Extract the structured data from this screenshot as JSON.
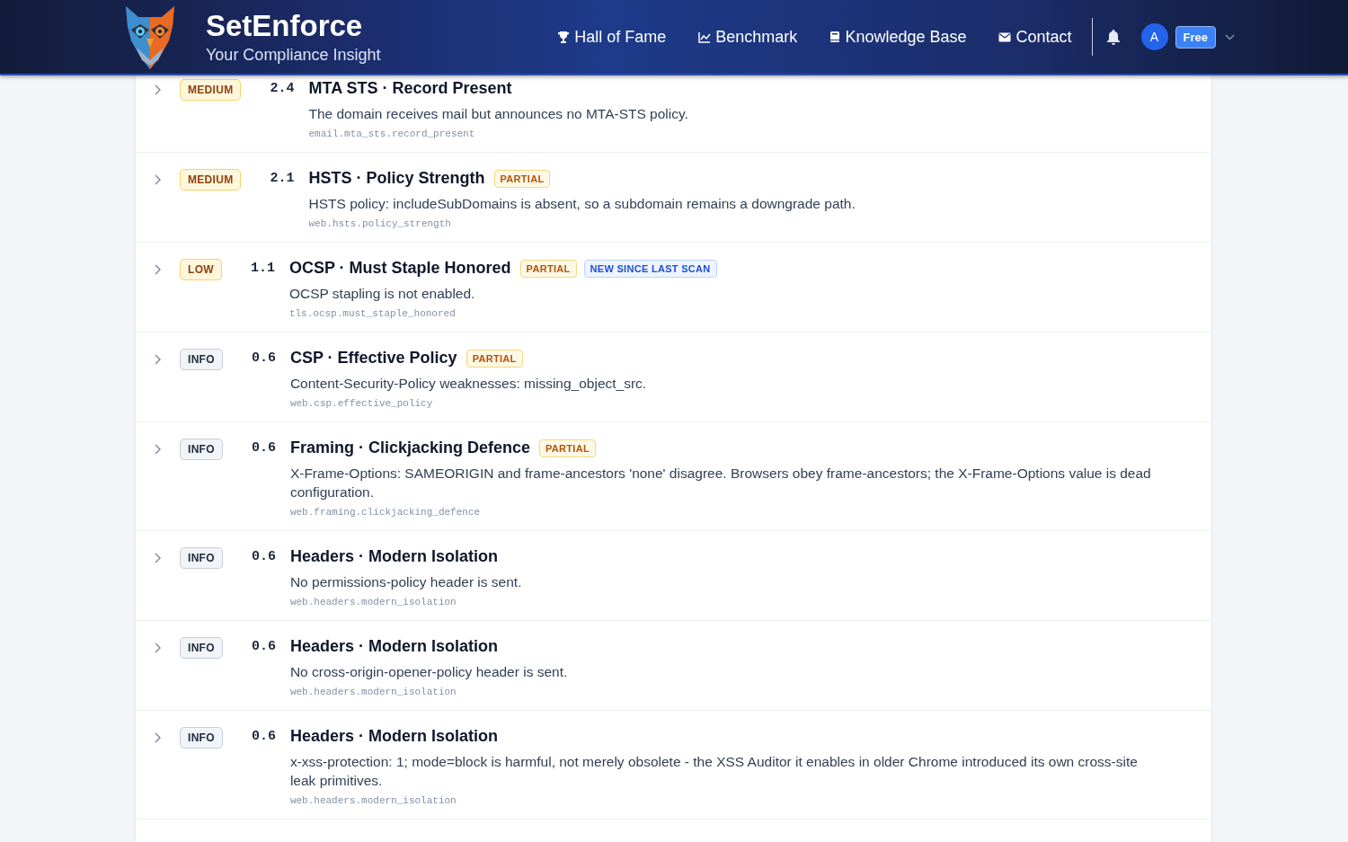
{
  "header": {
    "brand": "SetEnforce",
    "tagline": "Your Compliance Insight",
    "nav": [
      {
        "label": "Hall of Fame",
        "kind": "trophy"
      },
      {
        "label": "Benchmark",
        "kind": "chart"
      },
      {
        "label": "Knowledge Base",
        "kind": "book"
      },
      {
        "label": "Contact",
        "kind": "mail"
      }
    ],
    "avatar": "A",
    "plan": "Free"
  },
  "findings": [
    {
      "expanded": false,
      "severity": {
        "label": "MEDIUM",
        "kind": "medium"
      },
      "score": "2.4",
      "title": "MTA STS · Record Present",
      "description": "The domain receives mail but announces no MTA-STS policy.",
      "check_id": "email.mta_sts.record_present"
    },
    {
      "expanded": false,
      "severity": {
        "label": "MEDIUM",
        "kind": "medium"
      },
      "score": "2.1",
      "title": "HSTS · Policy Strength",
      "tags": [
        {
          "label": "PARTIAL",
          "kind": "partial"
        }
      ],
      "description": "HSTS policy: includeSubDomains is absent, so a subdomain remains a downgrade path.",
      "check_id": "web.hsts.policy_strength"
    },
    {
      "expanded": false,
      "severity": {
        "label": "LOW",
        "kind": "low"
      },
      "score": "1.1",
      "title": "OCSP · Must Staple Honored",
      "tags": [
        {
          "label": "PARTIAL",
          "kind": "partial"
        },
        {
          "label": "NEW SINCE LAST SCAN",
          "kind": "new"
        }
      ],
      "description": "OCSP stapling is not enabled.",
      "check_id": "tls.ocsp.must_staple_honored"
    },
    {
      "expanded": false,
      "severity": {
        "label": "INFO",
        "kind": "info"
      },
      "score": "0.6",
      "title": "CSP · Effective Policy",
      "tags": [
        {
          "label": "PARTIAL",
          "kind": "partial"
        }
      ],
      "description": "Content-Security-Policy weaknesses: missing_object_src.",
      "check_id": "web.csp.effective_policy"
    },
    {
      "expanded": false,
      "severity": {
        "label": "INFO",
        "kind": "info"
      },
      "score": "0.6",
      "title": "Framing · Clickjacking Defence",
      "tags": [
        {
          "label": "PARTIAL",
          "kind": "partial"
        }
      ],
      "description": "X-Frame-Options: SAMEORIGIN and frame-ancestors 'none' disagree. Browsers obey frame-ancestors; the X-Frame-Options value is dead configuration.",
      "check_id": "web.framing.clickjacking_defence"
    },
    {
      "expanded": false,
      "severity": {
        "label": "INFO",
        "kind": "info"
      },
      "score": "0.6",
      "title": "Headers · Modern Isolation",
      "description": "No permissions-policy header is sent.",
      "check_id": "web.headers.modern_isolation"
    },
    {
      "expanded": false,
      "severity": {
        "label": "INFO",
        "kind": "info"
      },
      "score": "0.6",
      "title": "Headers · Modern Isolation",
      "description": "No cross-origin-opener-policy header is sent.",
      "check_id": "web.headers.modern_isolation"
    },
    {
      "expanded": false,
      "severity": {
        "label": "INFO",
        "kind": "info"
      },
      "score": "0.6",
      "title": "Headers · Modern Isolation",
      "description": "x-xss-protection: 1; mode=block is harmful, not merely obsolete - the XSS Auditor it enables in older Chrome introduced its own cross-site leak primitives.",
      "check_id": "web.headers.modern_isolation"
    }
  ]
}
